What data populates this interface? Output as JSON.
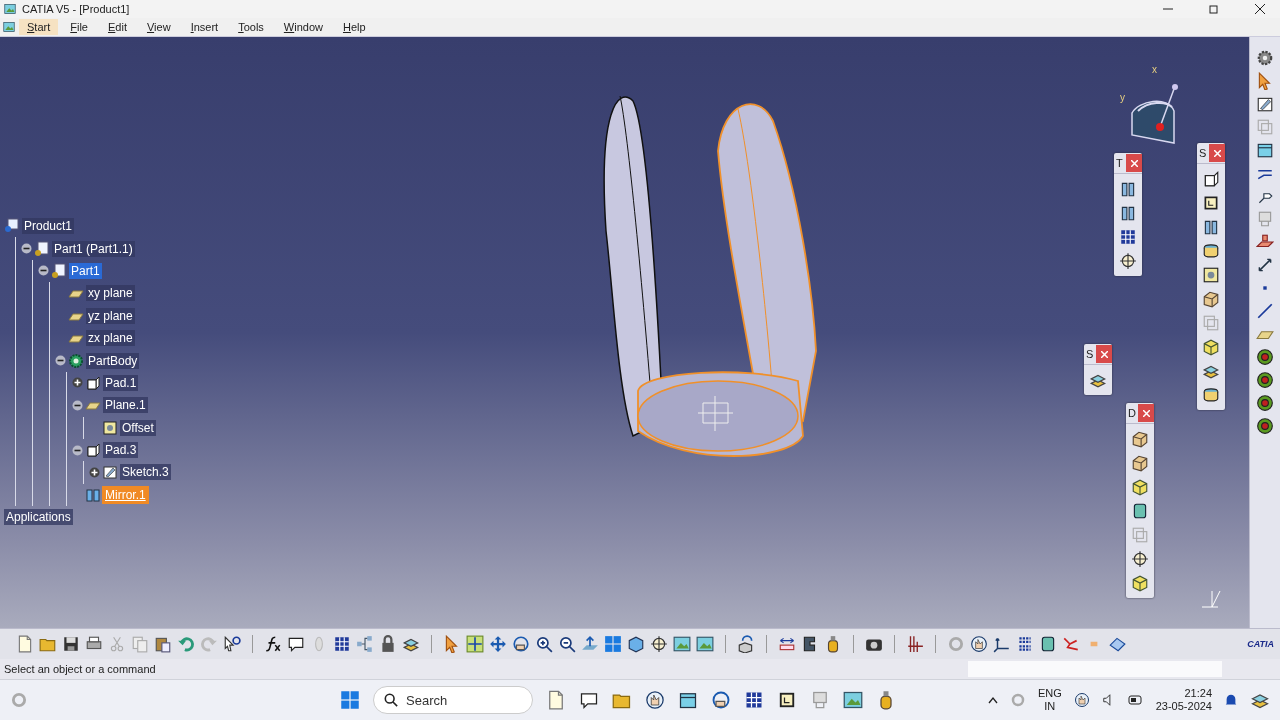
{
  "window": {
    "title": "CATIA V5 - [Product1]"
  },
  "menu": [
    {
      "label": "Start",
      "selected": true
    },
    {
      "label": "File",
      "selected": false
    },
    {
      "label": "Edit",
      "selected": false
    },
    {
      "label": "View",
      "selected": false
    },
    {
      "label": "Insert",
      "selected": false
    },
    {
      "label": "Tools",
      "selected": false
    },
    {
      "label": "Window",
      "selected": false
    },
    {
      "label": "Help",
      "selected": false
    }
  ],
  "tree": [
    {
      "label": "Product1",
      "kind": "product",
      "selected": false,
      "hovered": false,
      "children": [
        {
          "label": "Part1 (Part1.1)",
          "kind": "part",
          "selected": false,
          "hovered": false,
          "expanded": true,
          "children": [
            {
              "label": "Part1",
              "kind": "part",
              "selected": true,
              "hovered": false,
              "expanded": true,
              "children": [
                {
                  "label": "xy plane",
                  "kind": "plane",
                  "selected": false,
                  "hovered": false
                },
                {
                  "label": "yz plane",
                  "kind": "plane",
                  "selected": false,
                  "hovered": false
                },
                {
                  "label": "zx plane",
                  "kind": "plane",
                  "selected": false,
                  "hovered": false
                },
                {
                  "label": "PartBody",
                  "kind": "body",
                  "selected": false,
                  "hovered": false,
                  "expanded": true,
                  "children": [
                    {
                      "label": "Pad.1",
                      "kind": "pad",
                      "selected": false,
                      "hovered": false,
                      "expanded": false
                    },
                    {
                      "label": "Plane.1",
                      "kind": "plane",
                      "selected": false,
                      "hovered": false,
                      "expanded": true,
                      "children": [
                        {
                          "label": "Offset",
                          "kind": "offset",
                          "selected": false,
                          "hovered": false
                        }
                      ]
                    },
                    {
                      "label": "Pad.3",
                      "kind": "pad",
                      "selected": false,
                      "hovered": false,
                      "expanded": true,
                      "children": [
                        {
                          "label": "Sketch.3",
                          "kind": "sketch",
                          "selected": false,
                          "hovered": false,
                          "expanded": false
                        }
                      ]
                    },
                    {
                      "label": "Mirror.1",
                      "kind": "mirror",
                      "selected": false,
                      "hovered": true
                    }
                  ]
                }
              ]
            }
          ]
        }
      ]
    },
    {
      "label": "Applications",
      "kind": "none",
      "selected": false,
      "hovered": false
    }
  ],
  "toolbars": [
    {
      "title": "T"
    },
    {
      "title": "S"
    },
    {
      "title": "S"
    },
    {
      "title": "D"
    }
  ],
  "compass": {
    "x_label": "x",
    "y_label": "y"
  },
  "logo": "CATIA",
  "status_bar": {
    "message": "Select an object or a command"
  },
  "taskbar": {
    "search_placeholder": "Search",
    "language": "ENG",
    "region": "IN",
    "time": "21:24",
    "date": "23-05-2024"
  }
}
